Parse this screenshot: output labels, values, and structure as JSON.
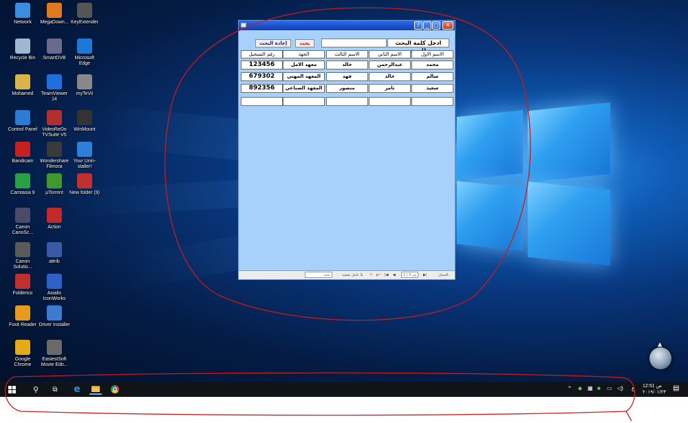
{
  "desktop_icons": [
    {
      "label": "Network",
      "icon": "network-icon",
      "color": "#3a8de0"
    },
    {
      "label": "MegaDown...",
      "icon": "megadownloader-icon",
      "color": "#e07a20"
    },
    {
      "label": "KeyExtender",
      "icon": "keyextender-icon",
      "color": "#555555"
    },
    {
      "label": "Recycle Bin",
      "icon": "recycle-bin-icon",
      "color": "#9fb7cf"
    },
    {
      "label": "SmartDVB",
      "icon": "smartdvb-icon",
      "color": "#6a6a8a"
    },
    {
      "label": "Microsoft Edge",
      "icon": "edge-icon",
      "color": "#1e79d6"
    },
    {
      "label": "Mohamed",
      "icon": "user-folder-icon",
      "color": "#d9b44a"
    },
    {
      "label": "TeamViewer 14",
      "icon": "teamviewer-icon",
      "color": "#1f6fdc"
    },
    {
      "label": "myTeVii",
      "icon": "mytevii-icon",
      "color": "#888888"
    },
    {
      "label": "Control Panel",
      "icon": "control-panel-icon",
      "color": "#2e7bd6"
    },
    {
      "label": "VideoReDo TVSuite V5",
      "icon": "videoredo-icon",
      "color": "#b03030"
    },
    {
      "label": "WinMount",
      "icon": "winmount-icon",
      "color": "#333333"
    },
    {
      "label": "Bandicam",
      "icon": "bandicam-icon",
      "color": "#c82020"
    },
    {
      "label": "Wondershare Filmora",
      "icon": "filmora-icon",
      "color": "#3a3a3a"
    },
    {
      "label": "Your Unin-staller!",
      "icon": "uninstaller-icon",
      "color": "#2f7fd9"
    },
    {
      "label": "Camtasia 9",
      "icon": "camtasia-icon",
      "color": "#2aa046"
    },
    {
      "label": "µTorrent",
      "icon": "utorrent-icon",
      "color": "#3f9a2e"
    },
    {
      "label": "New folder (9)",
      "icon": "pdf-folder-icon",
      "color": "#c03030"
    },
    {
      "label": "Canon CanoSc...",
      "icon": "canon-icon",
      "color": "#4a4a6a"
    },
    {
      "label": "Action",
      "icon": "action-icon",
      "color": "#c02a2a"
    },
    {
      "label": "Canon Solutio...",
      "icon": "canon-solution-icon",
      "color": "#5a5a5a"
    },
    {
      "label": "attrib",
      "icon": "attrib-icon",
      "color": "#3a5aa8"
    },
    {
      "label": "Folderico",
      "icon": "folderico-icon",
      "color": "#c03030"
    },
    {
      "label": "Axialis IconWorks",
      "icon": "iconworks-icon",
      "color": "#2f62c8"
    },
    {
      "label": "Foxit Reader",
      "icon": "foxit-icon",
      "color": "#e59a20"
    },
    {
      "label": "Driver Installer",
      "icon": "driver-installer-icon",
      "color": "#3d7bd0"
    },
    {
      "label": "Google Chrome",
      "icon": "chrome-icon",
      "color": "#e6a91a"
    },
    {
      "label": "EasiestSoft Movie Edit...",
      "icon": "movie-editor-icon",
      "color": "#6a6a6a"
    }
  ],
  "form": {
    "search_label": "ادخل كلمة البحث للجهة",
    "search_value": "",
    "search_button": "بحث",
    "reset_button": "إعادة البحث",
    "columns": [
      "الاسم الاول",
      "الاسم الثاني",
      "الاسم الثالث",
      "الجهة",
      "رقم التسجيل"
    ],
    "rows": [
      [
        "محمد",
        "عبدالرحمن",
        "خالد",
        "معهد الامل",
        "123456"
      ],
      [
        "سالم",
        "خالد",
        "فهد",
        "المعهد المهني",
        "679302"
      ],
      [
        "سعيد",
        "ثامر",
        "منصور",
        "المعهد الصناعي",
        "892356"
      ],
      [
        "",
        "",
        "",
        "",
        ""
      ]
    ],
    "nav": {
      "record_label": "السجل:",
      "record_position": "1 | 3 من",
      "filter_label": "بلا عامل تصفية",
      "search_label": "بحث"
    }
  },
  "taskbar": {
    "clock_time": "12:51 ص",
    "clock_date": "٢٠١٩/٠١/٢٣",
    "lang": "ع"
  },
  "colors": {
    "form_background": "#a7d0fa",
    "annotation": "#cc1a1a",
    "search_button_text": "#d01010",
    "reset_button_text": "#1a1a90"
  }
}
